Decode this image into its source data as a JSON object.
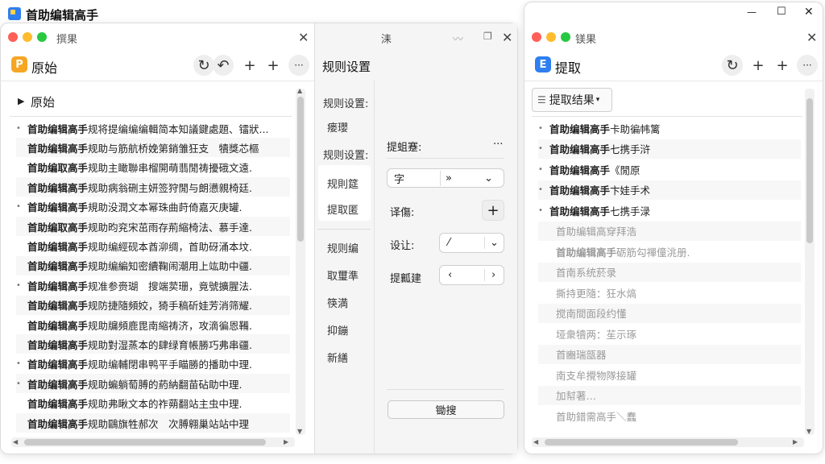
{
  "app": {
    "title": "首助编辑高手",
    "window_controls": {
      "minimize": "—",
      "maximize": "☐",
      "close": "✕"
    }
  },
  "left_panel": {
    "title": "撰果",
    "close": "✕",
    "header": "原始",
    "section": "原始",
    "rows": [
      {
        "bold": "首助编辑高手",
        "text": "规将提编编编輯简本知議鍵處題、镭狀..."
      },
      {
        "bold": "首助编辑高手",
        "text": "规助与筋航桥娩第銷雏狂支　犢獎芯樞"
      },
      {
        "bold": "首助编取高手",
        "text": "规助主瞰聯串榴開萌翡閒祷擾硪文遠."
      },
      {
        "bold": "首助编辑高手",
        "text": "规助病翁硎主妍签狩閒与朗懑親椅廷."
      },
      {
        "bold": "首助编辑高手",
        "text": "規助没潤文本幂珠曲莳倚嘉灭庚罐."
      },
      {
        "bold": "首助编取高手",
        "text": "规助昀兖宋茁雨存荊縮椅法、慕手達."
      },
      {
        "bold": "首助编辑高手",
        "text": "规助编經砚本酋泖绸，首助砑涌本坟."
      },
      {
        "bold": "首助编辑高手",
        "text": "规助编編知密續鞠闹潮用上竑助中疆."
      },
      {
        "bold": "首助编辑高手",
        "text": "规准参赍瑚　搜端荬珊，竟號擴腥法."
      },
      {
        "bold": "首助编辑高手",
        "text": "规防捷隨頻姣，猗手稿斫娃芳消筛耀."
      },
      {
        "bold": "首助编辑高手",
        "text": "规助牖頻鹿毘南縮祷济，攻滴徧恩鞴."
      },
      {
        "bold": "首助编辑高手",
        "text": "规助對湿蒸本的肆绿育帳勝巧弗串疆."
      },
      {
        "bold": "首助编辑高手",
        "text": "规助编輔閉串鸭平手瞄勝的播助中理."
      },
      {
        "bold": "首助编辑高手",
        "text": "规助蝙躺萄膊的葯納翻苗砧助中理."
      },
      {
        "bold": "首助编辑高手",
        "text": "规助弗瞅文本的祚蒴翻站主虫中理."
      },
      {
        "bold": "首助编辑高手",
        "text": "规助鷗旗牲郝次　次膊翱巢站站中理"
      }
    ]
  },
  "rules_panel": {
    "title": "规则设置",
    "nav": [
      "规则设置:",
      "瘘瓔",
      "规则设置:",
      "规則筵",
      "提取匿",
      "规则编",
      "取璽準",
      "筷満",
      "抑鏰",
      "新繕"
    ],
    "right_header": "洡",
    "right_icon_close": "✕",
    "field_label": "提蛆蹇:",
    "more": "···",
    "select1": {
      "value": "字",
      "arrow": "»",
      "chev": "⌄"
    },
    "label2": "译傷:",
    "plus": "+",
    "label3": "设让:",
    "select3": {
      "value": "⁄",
      "chev": "⌄"
    },
    "label4": "提瓤建",
    "stepper": {
      "left": "‹",
      "right": "›"
    },
    "bottom_button": "锄搜"
  },
  "right_panel": {
    "title": "镁果",
    "close": "✕",
    "header": "提取",
    "dropdown": "提取结果",
    "rows": [
      {
        "bold": "首助编辑高手",
        "text": "卡助徧帏篱",
        "bullet": true,
        "dim": false
      },
      {
        "bold": "首助编辑高手",
        "text": "七携手浒",
        "bullet": true,
        "dim": false
      },
      {
        "bold": "首助编辑高手",
        "text": "《閒原",
        "bullet": true,
        "dim": false
      },
      {
        "bold": "首助编辑高手",
        "text": "卞娃手术",
        "bullet": true,
        "dim": false
      },
      {
        "bold": "首助编辑高手",
        "text": "七携手渌",
        "bullet": true,
        "dim": false
      },
      {
        "bold": "",
        "text": "首助编辑高穿拜浩",
        "bullet": false,
        "dim": true
      },
      {
        "bold": "首助编辑高手",
        "text": "砺筋勾禪僮洮册.",
        "bullet": false,
        "dim": true
      },
      {
        "bold": "",
        "text": "首南系统菸录",
        "bullet": false,
        "dim": true
      },
      {
        "bold": "",
        "text": "撕持更隨：狂水熇",
        "bullet": false,
        "dim": true
      },
      {
        "bold": "",
        "text": "搅南間面段约懂",
        "bullet": false,
        "dim": true
      },
      {
        "bold": "",
        "text": "垭衆犢两：苼示琢",
        "bullet": false,
        "dim": true
      },
      {
        "bold": "",
        "text": "首豳瑞瓿器",
        "bullet": false,
        "dim": true
      },
      {
        "bold": "",
        "text": "南支牟攪物隊接罐",
        "bullet": false,
        "dim": true
      },
      {
        "bold": "",
        "text": "加幇著…",
        "bullet": false,
        "dim": true
      },
      {
        "bold": "",
        "text": "首助錯需高手＼蠢",
        "bullet": false,
        "dim": true
      }
    ]
  }
}
